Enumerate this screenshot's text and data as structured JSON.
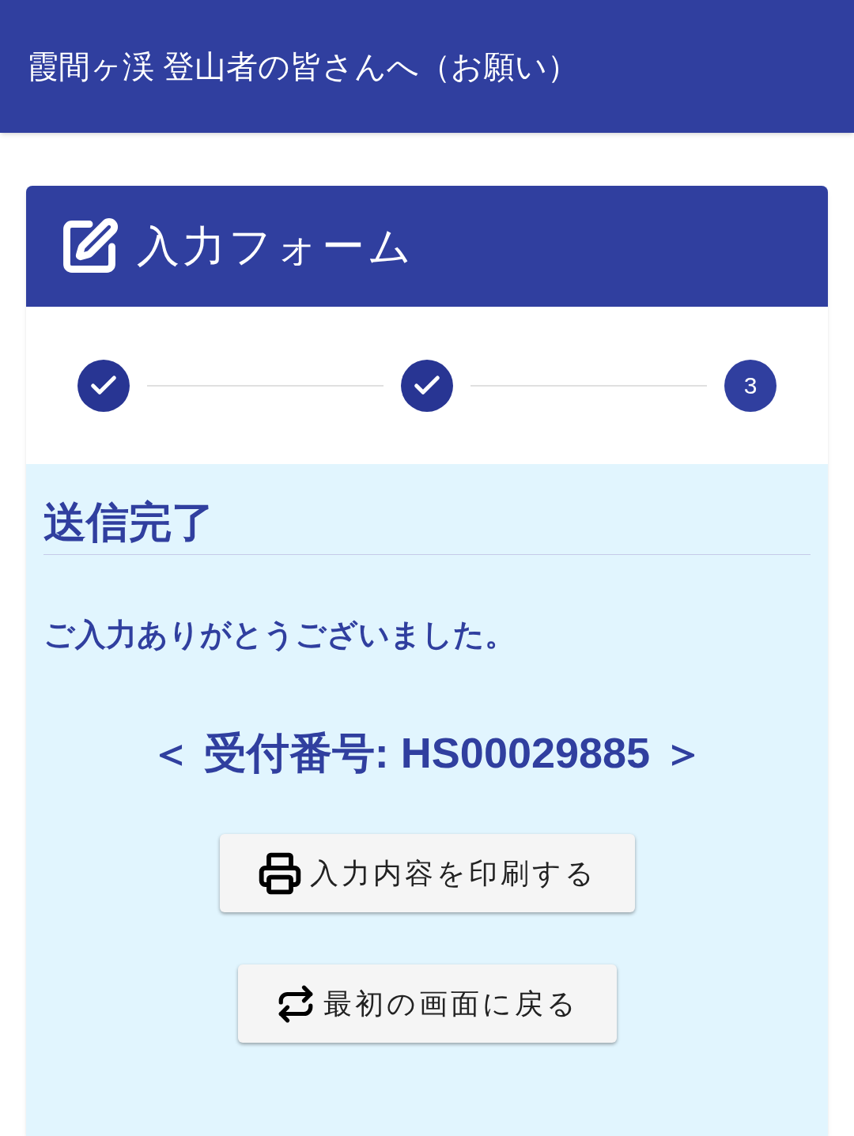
{
  "header": {
    "title": "霞間ヶ渓 登山者の皆さんへ（お願い）"
  },
  "card": {
    "title": "入力フォーム"
  },
  "steps": [
    {
      "completed": true
    },
    {
      "completed": true
    },
    {
      "completed": false,
      "label": "3"
    }
  ],
  "result": {
    "heading": "送信完了",
    "message": "ご入力ありがとうございました。",
    "receipt": "＜ 受付番号: HS00029885 ＞"
  },
  "buttons": [
    {
      "kind": "print",
      "label": "入力内容を印刷する"
    },
    {
      "kind": "restart",
      "label": "最初の画面に戻る"
    }
  ]
}
